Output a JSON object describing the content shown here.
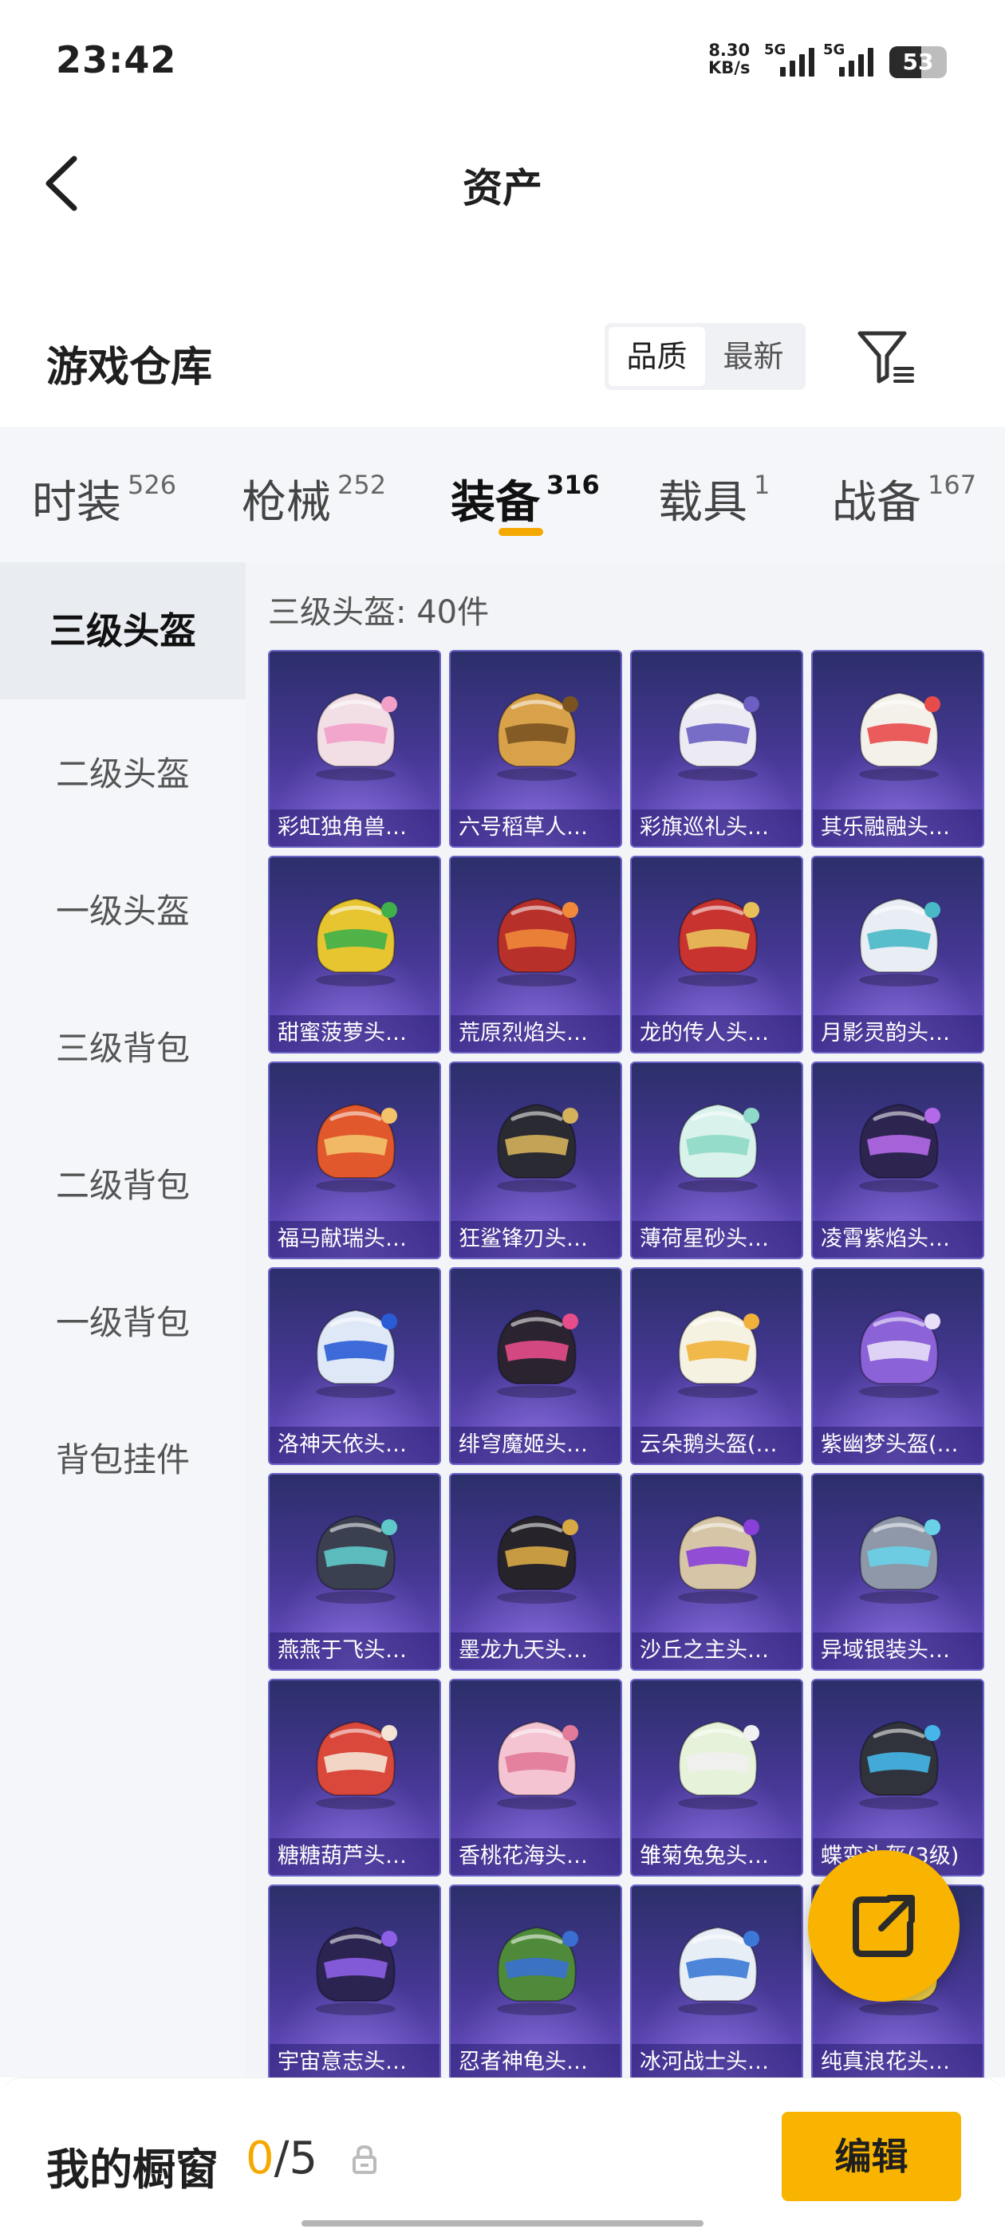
{
  "status": {
    "time": "23:42",
    "net_speed_value": "8.30",
    "net_speed_unit": "KB/s",
    "sim1": "5G",
    "sim2": "5G",
    "battery": "53"
  },
  "header": {
    "title": "资产"
  },
  "section": {
    "title": "游戏仓库",
    "sort_options": [
      "品质",
      "最新"
    ],
    "active_sort": "品质"
  },
  "category_tabs": [
    {
      "label": "时装",
      "count": "526"
    },
    {
      "label": "枪械",
      "count": "252"
    },
    {
      "label": "装备",
      "count": "316",
      "active": true
    },
    {
      "label": "载具",
      "count": "1"
    },
    {
      "label": "战备",
      "count": "167"
    }
  ],
  "sidebar": {
    "items": [
      "三级头盔",
      "二级头盔",
      "一级头盔",
      "三级背包",
      "二级背包",
      "一级背包",
      "背包挂件"
    ],
    "active": "三级头盔"
  },
  "content": {
    "count_label": "三级头盔: 40件",
    "items": [
      {
        "name": "彩虹独角兽…",
        "color": "#f2dfe6",
        "accent": "#f3a0c8"
      },
      {
        "name": "六号稻草人…",
        "color": "#d9a24a",
        "accent": "#7a5320"
      },
      {
        "name": "彩旗巡礼头…",
        "color": "#ecebf4",
        "accent": "#6c5fc1"
      },
      {
        "name": "其乐融融头…",
        "color": "#f4f1ea",
        "accent": "#e84b4b"
      },
      {
        "name": "甜蜜菠萝头…",
        "color": "#e7c531",
        "accent": "#3fb04a"
      },
      {
        "name": "荒原烈焰头…",
        "color": "#b8302a",
        "accent": "#f08a3a"
      },
      {
        "name": "龙的传人头…",
        "color": "#c8332f",
        "accent": "#e8c05a"
      },
      {
        "name": "月影灵韵头…",
        "color": "#e9edf4",
        "accent": "#49b8c7"
      },
      {
        "name": "福马献瑞头…",
        "color": "#e0582b",
        "accent": "#f3c36b"
      },
      {
        "name": "狂鲨锋刃头…",
        "color": "#2a2a32",
        "accent": "#d4b15a"
      },
      {
        "name": "薄荷星砂头…",
        "color": "#d9f2ec",
        "accent": "#8ed9c8"
      },
      {
        "name": "凌霄紫焰头…",
        "color": "#2d2550",
        "accent": "#b469e8"
      },
      {
        "name": "洛神天依头…",
        "color": "#dfe8f6",
        "accent": "#2a5cd6"
      },
      {
        "name": "绯穹魔姬头…",
        "color": "#2b2430",
        "accent": "#e64d8a"
      },
      {
        "name": "云朵鹅头盔(…",
        "color": "#f5f2e2",
        "accent": "#f0b23a"
      },
      {
        "name": "紫幽梦头盔(…",
        "color": "#8c62d9",
        "accent": "#e8e0f7"
      },
      {
        "name": "燕燕于飞头…",
        "color": "#3b4050",
        "accent": "#5fc9c9"
      },
      {
        "name": "墨龙九天头…",
        "color": "#26242a",
        "accent": "#d8a845"
      },
      {
        "name": "沙丘之主头…",
        "color": "#d6c5a6",
        "accent": "#8a3fd9"
      },
      {
        "name": "异域银装头…",
        "color": "#8e98a8",
        "accent": "#69d2e7"
      },
      {
        "name": "糖糖葫芦头…",
        "color": "#d9483a",
        "accent": "#f4e4d4"
      },
      {
        "name": "香桃花海头…",
        "color": "#f4c4d2",
        "accent": "#e27a99"
      },
      {
        "name": "雏菊兔兔头…",
        "color": "#e6f2da",
        "accent": "#f1f1f1"
      },
      {
        "name": "蝶变头盔(3级)",
        "color": "#30333b",
        "accent": "#46b6e8"
      },
      {
        "name": "宇宙意志头…",
        "color": "#2c2450",
        "accent": "#8c5fe6"
      },
      {
        "name": "忍者神龟头…",
        "color": "#4f8a3a",
        "accent": "#3a6fd1"
      },
      {
        "name": "冰河战士头…",
        "color": "#e8eef6",
        "accent": "#3c79d6"
      },
      {
        "name": "纯真浪花头…",
        "color": "#f3d24a",
        "accent": "#ffffff"
      }
    ]
  },
  "bottom": {
    "showcase_label": "我的橱窗",
    "showcase_current": "0",
    "showcase_total": "/5",
    "edit_label": "编辑"
  },
  "colors": {
    "accent": "#f8b400",
    "card_bg": "#473896"
  }
}
